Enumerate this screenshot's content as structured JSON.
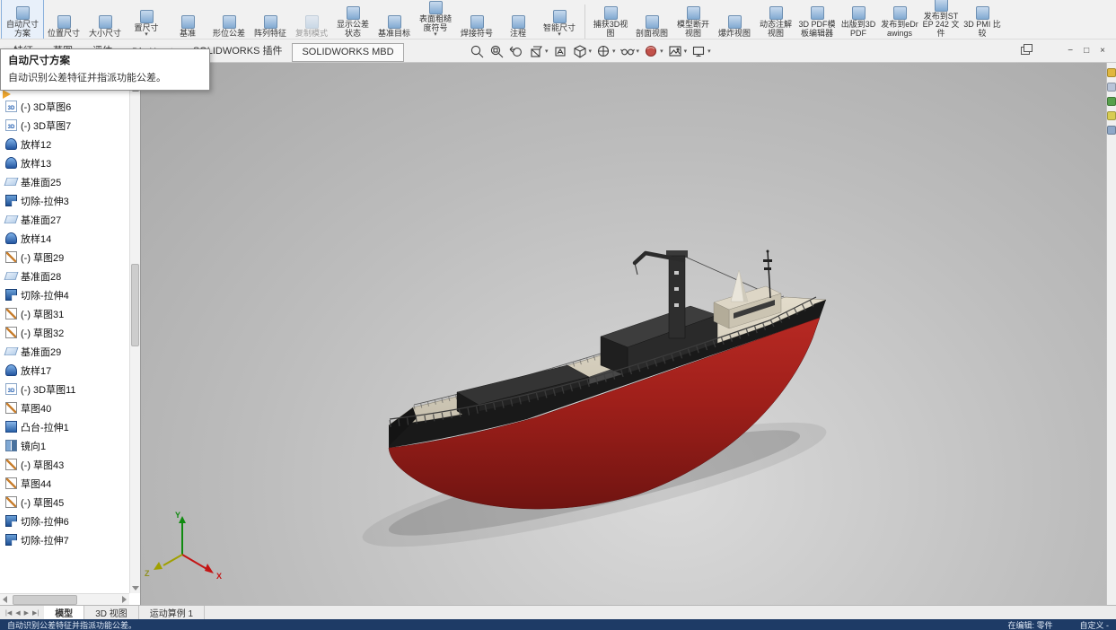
{
  "ribbon": {
    "buttons": [
      {
        "label": "自动尺寸方案",
        "highlight": true
      },
      {
        "label": "位置尺寸"
      },
      {
        "label": "大小尺寸"
      },
      {
        "label": "置尺寸",
        "caret": true
      },
      {
        "label": "基准"
      },
      {
        "label": "形位公差"
      },
      {
        "label": "阵列特征"
      },
      {
        "label": "复制模式",
        "disabled": true
      },
      {
        "label": "显示公差状态"
      },
      {
        "label": "基准目标"
      },
      {
        "label": "表面粗糙度符号",
        "caret": true
      },
      {
        "label": "焊接符号"
      },
      {
        "label": "注程"
      },
      {
        "label": "智能尺寸",
        "caret": true
      },
      {
        "label": "捕获3D视图",
        "separator_before": true
      },
      {
        "label": "剖面视图"
      },
      {
        "label": "模型断开视图"
      },
      {
        "label": "爆炸视图"
      },
      {
        "label": "动态注解视图"
      },
      {
        "label": "3D PDF模板编辑器"
      },
      {
        "label": "出版到3D PDF"
      },
      {
        "label": "发布到eDrawings"
      },
      {
        "label": "发布到STEP 242 文件"
      },
      {
        "label": "3D PMI 比较"
      }
    ],
    "tabs": [
      {
        "label": "特征"
      },
      {
        "label": "草图"
      },
      {
        "label": "评估"
      },
      {
        "label": "DimXpert"
      },
      {
        "label": "SOLIDWORKS 插件"
      },
      {
        "label": "SOLIDWORKS MBD",
        "active": true
      }
    ]
  },
  "tooltip": {
    "title": "自动尺寸方案",
    "body": "自动识别公差特征并指派功能公差。"
  },
  "heads_up": {
    "icons": [
      "zoom-fit",
      "zoom-area",
      "previous-view",
      "section-view",
      "dynamic-annotation-views",
      "view-orientation",
      "display-style",
      "hide-show-items",
      "edit-appearance",
      "apply-scene",
      "view-settings"
    ],
    "dropdowns": [
      "section-view",
      "view-orientation",
      "display-style",
      "hide-show-items",
      "edit-appearance",
      "apply-scene",
      "view-settings"
    ]
  },
  "window_controls": [
    "cascade",
    "minimize",
    "restore",
    "close"
  ],
  "panel_toolbar": {
    "icons": [
      "document-icon",
      "list-icon",
      "hierarchy-icon"
    ],
    "nav": [
      "back",
      "forward"
    ]
  },
  "feature_tree": {
    "items": [
      {
        "icon": "sketch3d",
        "label": "(-) 3D草图6"
      },
      {
        "icon": "sketch3d",
        "label": "(-) 3D草图7"
      },
      {
        "icon": "loft",
        "label": "放样12"
      },
      {
        "icon": "loft",
        "label": "放样13"
      },
      {
        "icon": "plane",
        "label": "基准面25"
      },
      {
        "icon": "cut",
        "label": "切除-拉伸3"
      },
      {
        "icon": "plane",
        "label": "基准面27"
      },
      {
        "icon": "loft",
        "label": "放样14"
      },
      {
        "icon": "sketch",
        "label": "(-) 草图29"
      },
      {
        "icon": "plane",
        "label": "基准面28"
      },
      {
        "icon": "cut",
        "label": "切除-拉伸4"
      },
      {
        "icon": "sketch",
        "label": "(-) 草图31"
      },
      {
        "icon": "sketch",
        "label": "(-) 草图32"
      },
      {
        "icon": "plane",
        "label": "基准面29"
      },
      {
        "icon": "loft",
        "label": "放样17"
      },
      {
        "icon": "sketch3d",
        "label": "(-) 3D草图11"
      },
      {
        "icon": "sketch",
        "label": "草图40"
      },
      {
        "icon": "boss",
        "label": "凸台-拉伸1"
      },
      {
        "icon": "mirror",
        "label": "镜向1"
      },
      {
        "icon": "sketch",
        "label": "(-) 草图43"
      },
      {
        "icon": "sketch",
        "label": "草图44"
      },
      {
        "icon": "sketch",
        "label": "(-) 草图45"
      },
      {
        "icon": "cut",
        "label": "切除-拉伸6"
      },
      {
        "icon": "cut",
        "label": "切除-拉伸7"
      }
    ]
  },
  "task_pane": {
    "icons": [
      {
        "name": "resources-icon",
        "color": "#e0b73e"
      },
      {
        "name": "design-library-icon",
        "color": "#b8c4d8"
      },
      {
        "name": "file-explorer-icon",
        "color": "#57a04c"
      },
      {
        "name": "view-palette-icon",
        "color": "#d8cc52"
      },
      {
        "name": "appearances-icon",
        "color": "#8fa8c8"
      }
    ]
  },
  "viewport": {
    "triad": {
      "x_label": "X",
      "y_label": "Y",
      "z_label": "Z"
    }
  },
  "bottom_tabs": {
    "tabs": [
      {
        "label": "模型",
        "active": true
      },
      {
        "label": "3D 视图"
      },
      {
        "label": "运动算例 1"
      }
    ]
  },
  "status_bar": {
    "hint": "自动识别公差特征并指派功能公差。",
    "editing": "在编辑: 零件",
    "custom": "自定义 -"
  },
  "colors": {
    "hull_red": "#9e1f1a",
    "hull_band": "#191919",
    "deck": "#d9d2c2",
    "status_bar": "#1e3b66"
  }
}
